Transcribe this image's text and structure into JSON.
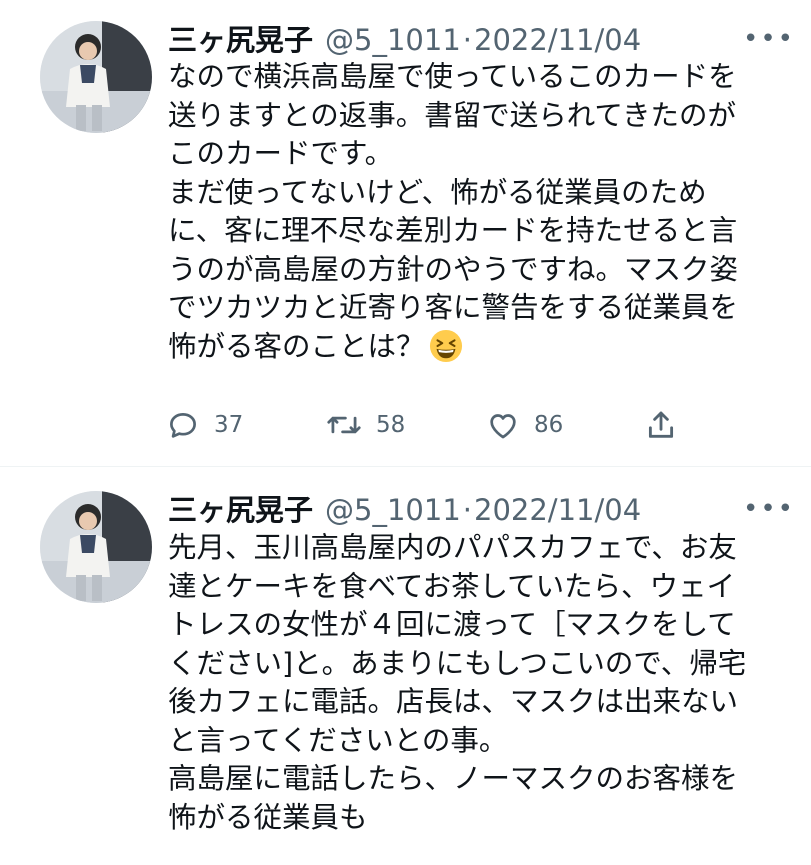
{
  "tweets": [
    {
      "author_name": "三ヶ尻晃子",
      "handle": "@5_1011",
      "separator": "·",
      "date": "2022/11/04",
      "more_label": "•••",
      "lines": [
        "なので横浜高島屋で使っているこのカードを",
        "送りますとの返事。書留で送られてきたのが",
        "このカードです。",
        "まだ使ってないけど、怖がる従業員のため",
        "に、客に理不尽な差別カードを持たせると言",
        "うのが高島屋の方針のやうですね。マスク姿",
        "でツカツカと近寄り客に警告をする従業員を",
        "怖がる客のことは？"
      ],
      "emoji": "grinning-squinting-face",
      "reply_count": "37",
      "retweet_count": "58",
      "like_count": "86"
    },
    {
      "author_name": "三ヶ尻晃子",
      "handle": "@5_1011",
      "separator": "·",
      "date": "2022/11/04",
      "more_label": "•••",
      "lines": [
        "先月、玉川高島屋内のパパスカフェで、お友",
        "達とケーキを食べてお茶していたら、ウェイ",
        "トレスの女性が４回に渡って［マスクをして",
        "ください]と。あまりにもしつこいので、帰宅",
        "後カフェに電話。店長は、マスクは出来ない",
        "と言ってくださいとの事。",
        "高島屋に電話したら、ノーマスクのお客様を",
        "怖がる従業員も"
      ]
    }
  ],
  "icons": [
    "reply-icon",
    "retweet-icon",
    "like-icon",
    "share-icon",
    "more-icon"
  ],
  "colors": {
    "text": "#0f1419",
    "secondary": "#536471",
    "divider": "#eff3f4"
  }
}
